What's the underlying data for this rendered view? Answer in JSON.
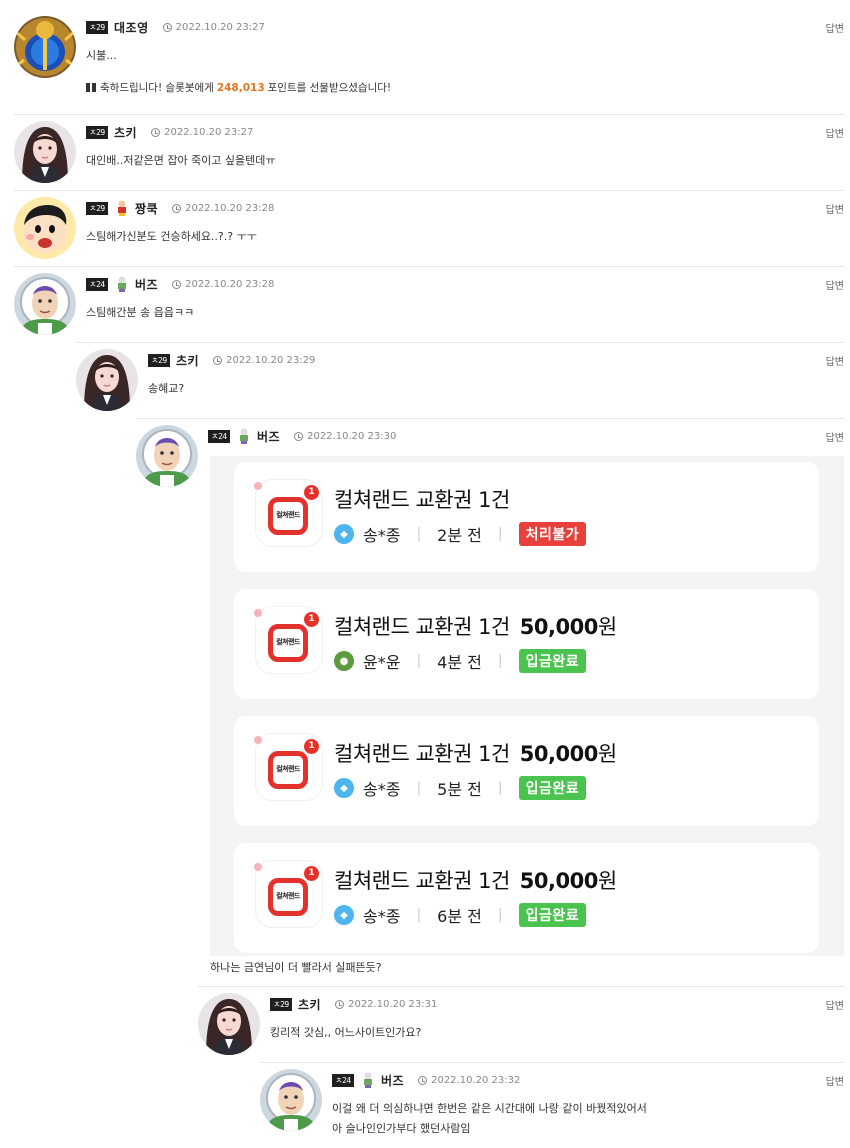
{
  "reply_label": "답변",
  "comments": [
    {
      "level": "ㅊ29",
      "nick": "대조영",
      "time": "2022.10.20 23:27",
      "lines": [
        "시불..."
      ],
      "gift": {
        "prefix": "축하드립니다! 슬롯봇에게",
        "points": "248,013",
        "suffix": "포인트를 선물받으셨습니다!"
      }
    },
    {
      "level": "ㅊ29",
      "nick": "츠키",
      "time": "2022.10.20 23:27",
      "lines": [
        "대인배..저같은면 잡아 죽이고 싶을텐데ㅠ"
      ]
    },
    {
      "level": "ㅊ29",
      "nick": "짱쿡",
      "time": "2022.10.20 23:28",
      "lines": [
        "스팀해가신분도 건승하세요..?.? ㅜㅜ"
      ]
    },
    {
      "level": "ㅊ24",
      "nick": "버즈",
      "time": "2022.10.20 23:28",
      "lines": [
        "스팀해간분 송 읍읍ㅋㅋ"
      ]
    },
    {
      "level": "ㅊ29",
      "nick": "츠키",
      "time": "2022.10.20 23:29",
      "lines": [
        "송혜교?"
      ]
    },
    {
      "level": "ㅊ24",
      "nick": "버즈",
      "time": "2022.10.20 23:30",
      "lines": [
        "하나는 금연님이 더 빨라서 실패뜬듯?"
      ]
    },
    {
      "level": "ㅊ29",
      "nick": "츠키",
      "time": "2022.10.20 23:31",
      "lines": [
        "킹리적 갓심,, 어느사이트인가요?"
      ]
    },
    {
      "level": "ㅊ24",
      "nick": "버즈",
      "time": "2022.10.20 23:32",
      "lines": [
        "이걸 왜 더 의심하냐면 한번은 같은 시간대에 나랑 같이 바꿨적있어서",
        "아 슬나인인가부다 했던사람임"
      ]
    }
  ],
  "screenshot": {
    "app_label": "컬쳐랜드",
    "badge": "1",
    "cards": [
      {
        "title": "컬쳐랜드 교환권 1건",
        "amount": "",
        "unit": "",
        "bank_icon": "blue-bank-icon",
        "name": "송*종",
        "ago": "2분 전",
        "status": "처리불가",
        "status_color": "#e8413d"
      },
      {
        "title": "컬쳐랜드 교환권 1건",
        "amount": "50,000",
        "unit": "원",
        "bank_icon": "green-bank-icon",
        "name": "윤*윤",
        "ago": "4분 전",
        "status": "입금완료",
        "status_color": "#4bc34f"
      },
      {
        "title": "컬쳐랜드 교환권 1건",
        "amount": "50,000",
        "unit": "원",
        "bank_icon": "blue-bank-icon",
        "name": "송*종",
        "ago": "5분 전",
        "status": "입금완료",
        "status_color": "#4bc34f"
      },
      {
        "title": "컬쳐랜드 교환권 1건",
        "amount": "50,000",
        "unit": "원",
        "bank_icon": "blue-bank-icon",
        "name": "송*종",
        "ago": "6분 전",
        "status": "입금완료",
        "status_color": "#4bc34f"
      }
    ]
  }
}
